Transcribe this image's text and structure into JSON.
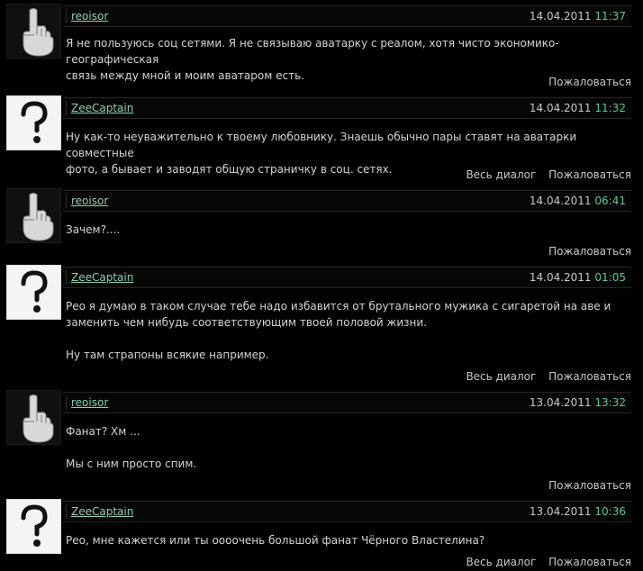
{
  "comments": [
    {
      "author": "reoisor",
      "avatar": "middle-finger",
      "date": "14.04.2011",
      "time": "11:37",
      "paragraphs": [
        "Я не пользуюсь соц сетями. Я не связываю аватарку с реалом, хотя чисто экономико-географическая",
        "связь между мной и моим аватаром есть."
      ],
      "dialog": "",
      "report": "Пожаловаться"
    },
    {
      "author": "ZeeCaptain",
      "avatar": "question-mark",
      "date": "14.04.2011",
      "time": "11:32",
      "paragraphs": [
        "Ну как-то неуважительно к твоему любовнику. Знаешь обычно пары ставят на аватарки совместные",
        "фото, а бывает и заводят общую страничку в соц. сетях."
      ],
      "dialog": "Весь диалог",
      "report": "Пожаловаться"
    },
    {
      "author": "reoisor",
      "avatar": "middle-finger",
      "date": "14.04.2011",
      "time": "06:41",
      "paragraphs": [
        "Зачем?...."
      ],
      "dialog": "",
      "report": "Пожаловаться"
    },
    {
      "author": "ZeeCaptain",
      "avatar": "question-mark",
      "date": "14.04.2011",
      "time": "01:05",
      "paragraphs": [
        "Рео я думаю в таком случае тебе надо избавится от брутального мужика с сигаретой на аве и",
        "заменить чем нибудь соответствующим твоей половой жизни.",
        "",
        "Ну там страпоны всякие например."
      ],
      "dialog": "Весь диалог",
      "report": "Пожаловаться"
    },
    {
      "author": "reoisor",
      "avatar": "middle-finger",
      "date": "13.04.2011",
      "time": "13:32",
      "paragraphs": [
        "Фанат? Хм ...",
        "",
        "Мы с ним просто спим."
      ],
      "dialog": "",
      "report": "Пожаловаться"
    },
    {
      "author": "ZeeCaptain",
      "avatar": "question-mark",
      "date": "13.04.2011",
      "time": "10:36",
      "paragraphs": [
        "Рео, мне кажется или ты оооочень большой фанат Чёрного Властелина?"
      ],
      "dialog": "Весь диалог",
      "report": "Пожаловаться"
    }
  ]
}
